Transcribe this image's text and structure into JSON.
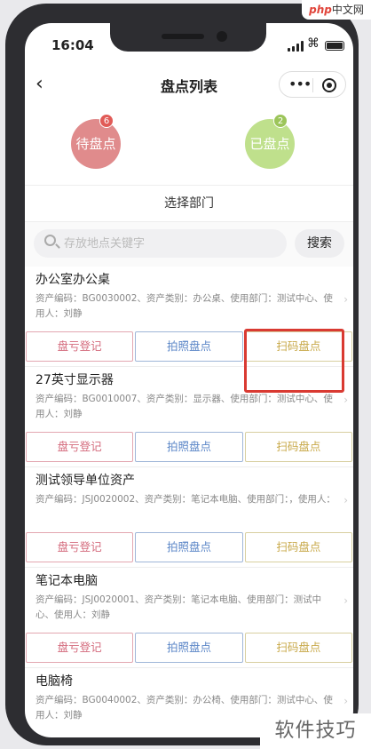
{
  "watermark_top": {
    "php": "php",
    "text": "中文网"
  },
  "watermark_bottom": "软件技巧",
  "status": {
    "time": "16:04"
  },
  "nav": {
    "title": "盘点列表"
  },
  "summary": {
    "pending": {
      "label": "待盘点",
      "count": "6"
    },
    "done": {
      "label": "已盘点",
      "count": "2"
    }
  },
  "department": {
    "label": "选择部门"
  },
  "search": {
    "placeholder": "存放地点关键字",
    "button": "搜索"
  },
  "actions": {
    "register": "盘亏登记",
    "photo": "拍照盘点",
    "scan": "扫码盘点"
  },
  "items": [
    {
      "name": "办公室办公桌",
      "info": "资产编码：BG0030002、资产类别：办公桌、使用部门：测试中心、使用人：刘静"
    },
    {
      "name": "27英寸显示器",
      "info": "资产编码：BG0010007、资产类别：显示器、使用部门：测试中心、使用人：刘静"
    },
    {
      "name": "测试领导单位资产",
      "info": "资产编码：JSJ0020002、资产类别：笔记本电脑、使用部门：，使用人："
    },
    {
      "name": "笔记本电脑",
      "info": "资产编码：JSJ0020001、资产类别：笔记本电脑、使用部门：测试中心、使用人：刘静"
    },
    {
      "name": "电脑椅",
      "info": "资产编码：BG0040002、资产类别：办公椅、使用部门：测试中心、使用人：刘静"
    }
  ],
  "colors": {
    "pending": "#e08b8c",
    "done": "#bfe08c",
    "highlight": "#d93a32"
  }
}
